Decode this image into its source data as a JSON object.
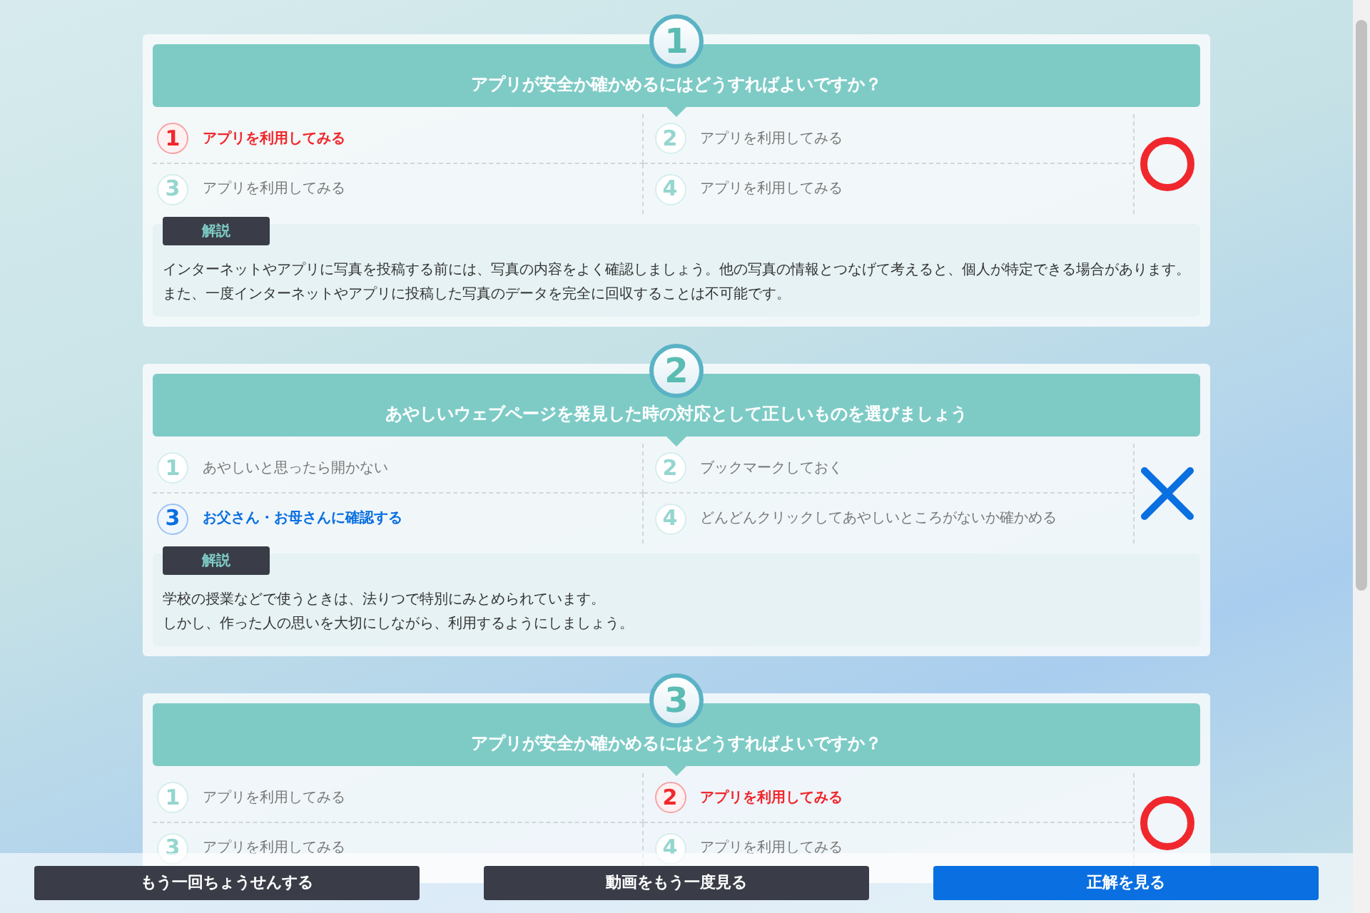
{
  "questions": [
    {
      "number": "1",
      "title": "アプリが安全か確かめるにはどうすればよいですか？",
      "correct": true,
      "options": [
        {
          "number": "1",
          "label": "アプリを利用してみる",
          "selected": true
        },
        {
          "number": "2",
          "label": "アプリを利用してみる",
          "selected": false
        },
        {
          "number": "3",
          "label": "アプリを利用してみる",
          "selected": false
        },
        {
          "number": "4",
          "label": "アプリを利用してみる",
          "selected": false
        }
      ],
      "explanation_tag": "解説",
      "explanation": [
        "インターネットやアプリに写真を投稿する前には、写真の内容をよく確認しましょう。他の写真の情報とつなげて考えると、個人が特定できる場合があります。また、一度インターネットやアプリに投稿した写真のデータを完全に回収することは不可能です。"
      ]
    },
    {
      "number": "2",
      "title": "あやしいウェブページを発見した時の対応として正しいものを選びましょう",
      "correct": false,
      "options": [
        {
          "number": "1",
          "label": "あやしいと思ったら開かない",
          "selected": false
        },
        {
          "number": "2",
          "label": "ブックマークしておく",
          "selected": false
        },
        {
          "number": "3",
          "label": "お父さん・お母さんに確認する",
          "selected": true
        },
        {
          "number": "4",
          "label": "どんどんクリックしてあやしいところがないか確かめる",
          "selected": false
        }
      ],
      "explanation_tag": "解説",
      "explanation": [
        "学校の授業などで使うときは、法りつで特別にみとめられています。",
        "しかし、作った人の思いを大切にしながら、利用するようにしましょう。"
      ]
    },
    {
      "number": "3",
      "title": "アプリが安全か確かめるにはどうすればよいですか？",
      "correct": true,
      "options": [
        {
          "number": "1",
          "label": "アプリを利用してみる",
          "selected": false
        },
        {
          "number": "2",
          "label": "アプリを利用してみる",
          "selected": true
        },
        {
          "number": "3",
          "label": "アプリを利用してみる",
          "selected": false
        },
        {
          "number": "4",
          "label": "アプリを利用してみる",
          "selected": false
        }
      ]
    }
  ],
  "buttons": [
    {
      "label": "もう一回ちょうせんする",
      "kind": "secondary"
    },
    {
      "label": "動画をもう一度見る",
      "kind": "secondary"
    },
    {
      "label": "正解を見る",
      "kind": "primary"
    }
  ]
}
